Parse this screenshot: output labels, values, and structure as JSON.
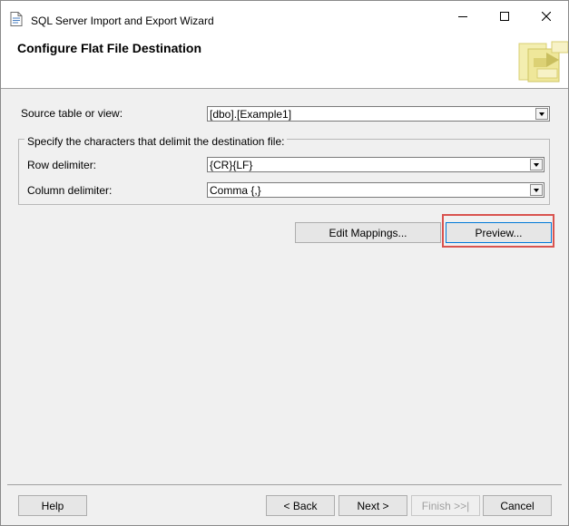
{
  "window": {
    "title": "SQL Server Import and Export Wizard"
  },
  "header": {
    "title": "Configure Flat File Destination"
  },
  "form": {
    "source_label": "Source table or view:",
    "source_value": "[dbo].[Example1]",
    "group_caption": "Specify the characters that delimit the destination file:",
    "row_delim_label": "Row delimiter:",
    "row_delim_value": "{CR}{LF}",
    "col_delim_label": "Column delimiter:",
    "col_delim_value": "Comma {,}"
  },
  "actions": {
    "edit_mappings": "Edit Mappings...",
    "preview": "Preview..."
  },
  "footer": {
    "help": "Help",
    "back": "< Back",
    "next": "Next >",
    "finish": "Finish >>|",
    "cancel": "Cancel"
  },
  "colors": {
    "highlight": "#d9534f",
    "focus": "#0078d7"
  }
}
